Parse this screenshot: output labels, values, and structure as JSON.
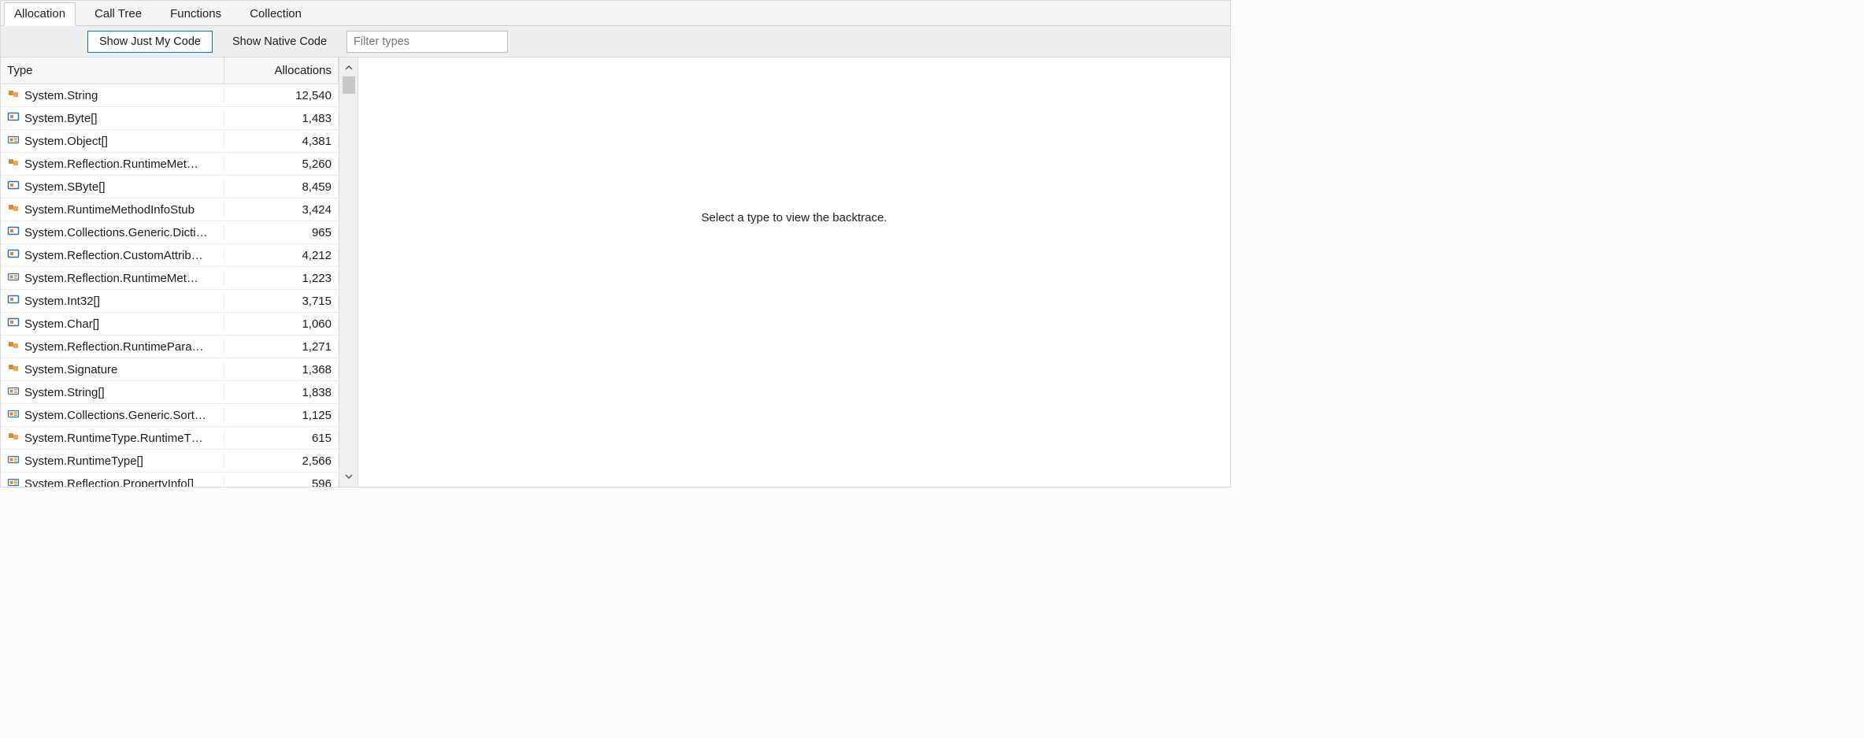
{
  "tabs": [
    {
      "label": "Allocation",
      "selected": true
    },
    {
      "label": "Call Tree",
      "selected": false
    },
    {
      "label": "Functions",
      "selected": false
    },
    {
      "label": "Collection",
      "selected": false
    }
  ],
  "toolbar": {
    "show_just_my_code_label": "Show Just My Code",
    "show_native_code_label": "Show Native Code",
    "filter_placeholder": "Filter types"
  },
  "columns": {
    "type_header": "Type",
    "allocations_header": "Allocations"
  },
  "rows": [
    {
      "icon": "class",
      "name": "System.String",
      "alloc": "12,540"
    },
    {
      "icon": "struct",
      "name": "System.Byte[]",
      "alloc": "1,483"
    },
    {
      "icon": "array",
      "name": "System.Object[]",
      "alloc": "4,381"
    },
    {
      "icon": "class",
      "name": "System.Reflection.RuntimeMet…",
      "alloc": "5,260"
    },
    {
      "icon": "struct",
      "name": "System.SByte[]",
      "alloc": "8,459"
    },
    {
      "icon": "class",
      "name": "System.RuntimeMethodInfoStub",
      "alloc": "3,424"
    },
    {
      "icon": "struct",
      "name": "System.Collections.Generic.Dicti…",
      "alloc": "965"
    },
    {
      "icon": "struct",
      "name": "System.Reflection.CustomAttrib…",
      "alloc": "4,212"
    },
    {
      "icon": "array",
      "name": "System.Reflection.RuntimeMet…",
      "alloc": "1,223"
    },
    {
      "icon": "struct",
      "name": "System.Int32[]",
      "alloc": "3,715"
    },
    {
      "icon": "struct",
      "name": "System.Char[]",
      "alloc": "1,060"
    },
    {
      "icon": "class",
      "name": "System.Reflection.RuntimePara…",
      "alloc": "1,271"
    },
    {
      "icon": "class",
      "name": "System.Signature",
      "alloc": "1,368"
    },
    {
      "icon": "array",
      "name": "System.String[]",
      "alloc": "1,838"
    },
    {
      "icon": "array",
      "name": "System.Collections.Generic.Sort…",
      "alloc": "1,125"
    },
    {
      "icon": "class",
      "name": "System.RuntimeType.RuntimeT…",
      "alloc": "615"
    },
    {
      "icon": "array",
      "name": "System.RuntimeType[]",
      "alloc": "2,566"
    },
    {
      "icon": "array",
      "name": "System.Reflection.PropertyInfo[]",
      "alloc": "596"
    }
  ],
  "detail": {
    "empty_message": "Select a type to view the backtrace."
  }
}
